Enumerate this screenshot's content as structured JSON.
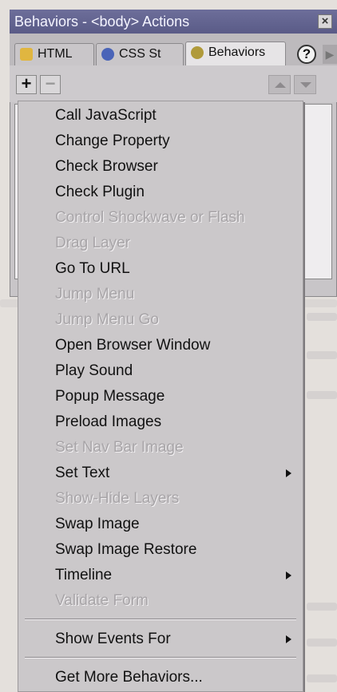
{
  "panel": {
    "title": "Behaviors - <body> Actions",
    "tabs": [
      {
        "label": "HTML",
        "icon": "paragraph-icon"
      },
      {
        "label": "CSS St",
        "icon": "css-styles-icon"
      },
      {
        "label": "Behaviors",
        "icon": "gear-icon"
      }
    ],
    "help_label": "?",
    "toolbar": {
      "add_label": "+",
      "remove_label": "−"
    }
  },
  "menu": {
    "items": [
      {
        "label": "Call JavaScript",
        "enabled": true
      },
      {
        "label": "Change Property",
        "enabled": true
      },
      {
        "label": "Check Browser",
        "enabled": true
      },
      {
        "label": "Check Plugin",
        "enabled": true
      },
      {
        "label": "Control Shockwave or Flash",
        "enabled": false
      },
      {
        "label": "Drag Layer",
        "enabled": false
      },
      {
        "label": "Go To URL",
        "enabled": true
      },
      {
        "label": "Jump Menu",
        "enabled": false
      },
      {
        "label": "Jump Menu Go",
        "enabled": false
      },
      {
        "label": "Open Browser Window",
        "enabled": true
      },
      {
        "label": "Play Sound",
        "enabled": true
      },
      {
        "label": "Popup Message",
        "enabled": true
      },
      {
        "label": "Preload Images",
        "enabled": true
      },
      {
        "label": "Set Nav Bar Image",
        "enabled": false
      },
      {
        "label": "Set Text",
        "enabled": true,
        "submenu": true
      },
      {
        "label": "Show-Hide Layers",
        "enabled": false
      },
      {
        "label": "Swap Image",
        "enabled": true
      },
      {
        "label": "Swap Image Restore",
        "enabled": true
      },
      {
        "label": "Timeline",
        "enabled": true,
        "submenu": true
      },
      {
        "label": "Validate Form",
        "enabled": false
      }
    ],
    "show_events_for": {
      "label": "Show Events For",
      "submenu": true
    },
    "get_more": {
      "label": "Get More Behaviors..."
    }
  }
}
